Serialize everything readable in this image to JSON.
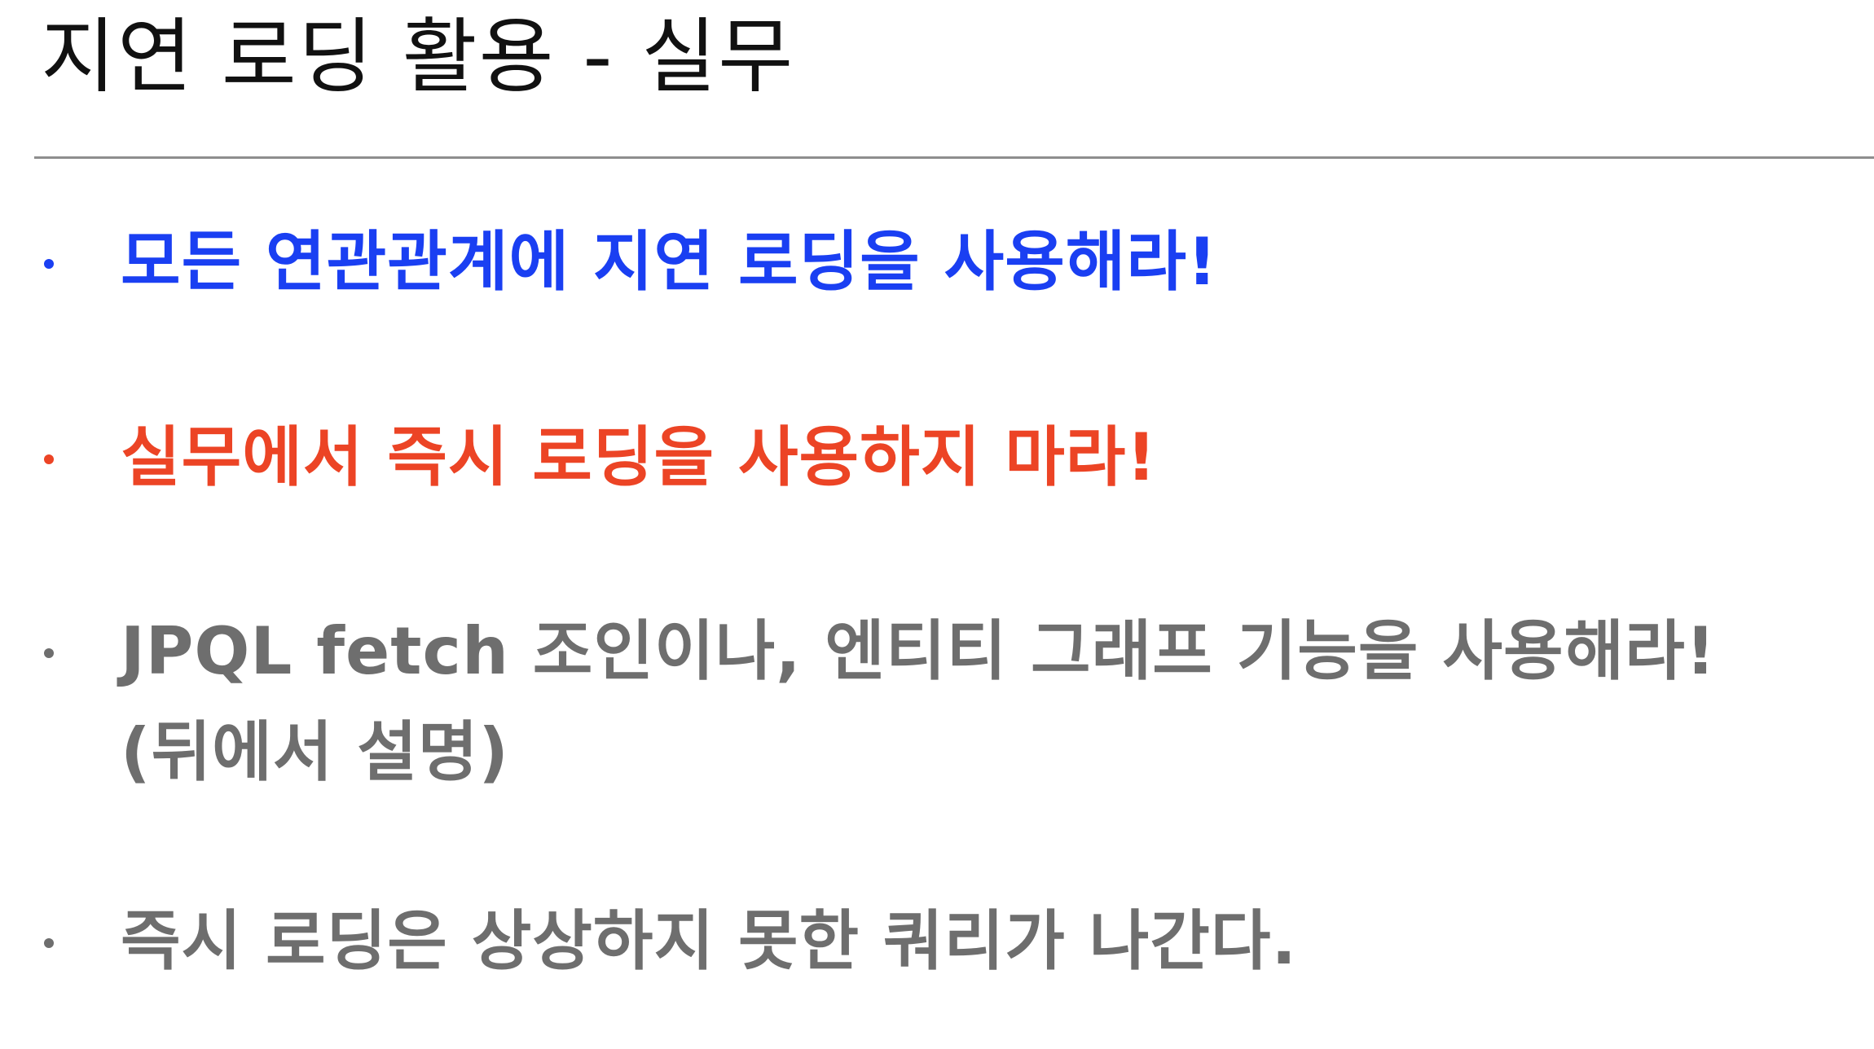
{
  "slide": {
    "title": "지연 로딩 활용 - 실무"
  },
  "bullets": [
    {
      "text": "모든 연관관계에 지연 로딩을 사용해라!",
      "color": "#1a3ff2"
    },
    {
      "text": "실무에서 즉시 로딩을 사용하지 마라!",
      "color": "#ec4425"
    },
    {
      "line1": "JPQL fetch 조인이나, 엔티티 그래프 기능을 사용해라!",
      "line2": "(뒤에서 설명)",
      "color": "#6e6e6e"
    },
    {
      "text": "즉시 로딩은 상상하지 못한 쿼리가 나간다.",
      "color": "#6e6e6e"
    }
  ]
}
